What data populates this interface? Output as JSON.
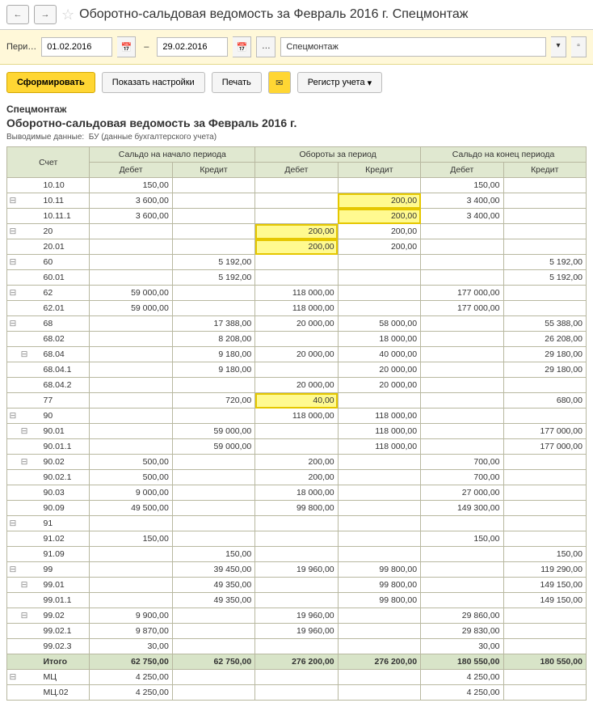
{
  "header": {
    "title": "Оборотно-сальдовая ведомость за Февраль 2016 г. Спецмонтаж"
  },
  "period": {
    "label": "Пери…",
    "from": "01.02.2016",
    "to": "29.02.2016",
    "org": "Спецмонтаж"
  },
  "toolbar": {
    "form": "Сформировать",
    "settings": "Показать настройки",
    "print": "Печать",
    "registry": "Регистр учета"
  },
  "report": {
    "org": "Спецмонтаж",
    "title": "Оборотно-сальдовая ведомость за Февраль 2016 г.",
    "meta_label": "Выводимые данные:",
    "meta_value": "БУ (данные бухгалтерского учета)",
    "cols": {
      "acct": "Счет",
      "open": "Сальдо на начало периода",
      "turn": "Обороты за период",
      "close": "Сальдо на конец периода",
      "debit": "Дебет",
      "credit": "Кредит"
    },
    "total_label": "Итого",
    "rows": [
      {
        "tree": [
          "",
          "",
          ""
        ],
        "acct": "10.10",
        "od": "150,00",
        "oc": "",
        "td": "",
        "tc": "",
        "cd": "150,00",
        "cc": ""
      },
      {
        "tree": [
          "⊟",
          "",
          ""
        ],
        "acct": "10.11",
        "od": "3 600,00",
        "oc": "",
        "td": "",
        "tc": "200,00",
        "cd": "3 400,00",
        "cc": "",
        "tc_hl": true
      },
      {
        "tree": [
          "",
          "",
          ""
        ],
        "acct": "10.11.1",
        "od": "3 600,00",
        "oc": "",
        "td": "",
        "tc": "200,00",
        "cd": "3 400,00",
        "cc": "",
        "tc_hl": true
      },
      {
        "tree": [
          "⊟",
          "",
          ""
        ],
        "acct": "20",
        "od": "",
        "oc": "",
        "td": "200,00",
        "tc": "200,00",
        "cd": "",
        "cc": "",
        "td_hl": true
      },
      {
        "tree": [
          "",
          "",
          ""
        ],
        "acct": "20.01",
        "od": "",
        "oc": "",
        "td": "200,00",
        "tc": "200,00",
        "cd": "",
        "cc": "",
        "td_hl": true
      },
      {
        "tree": [
          "⊟",
          "",
          ""
        ],
        "acct": "60",
        "od": "",
        "oc": "5 192,00",
        "td": "",
        "tc": "",
        "cd": "",
        "cc": "5 192,00"
      },
      {
        "tree": [
          "",
          "",
          ""
        ],
        "acct": "60.01",
        "od": "",
        "oc": "5 192,00",
        "td": "",
        "tc": "",
        "cd": "",
        "cc": "5 192,00"
      },
      {
        "tree": [
          "⊟",
          "",
          ""
        ],
        "acct": "62",
        "od": "59 000,00",
        "oc": "",
        "td": "118 000,00",
        "tc": "",
        "cd": "177 000,00",
        "cc": ""
      },
      {
        "tree": [
          "",
          "",
          ""
        ],
        "acct": "62.01",
        "od": "59 000,00",
        "oc": "",
        "td": "118 000,00",
        "tc": "",
        "cd": "177 000,00",
        "cc": ""
      },
      {
        "tree": [
          "⊟",
          "",
          ""
        ],
        "acct": "68",
        "od": "",
        "oc": "17 388,00",
        "td": "20 000,00",
        "tc": "58 000,00",
        "cd": "",
        "cc": "55 388,00"
      },
      {
        "tree": [
          "",
          "",
          ""
        ],
        "acct": "68.02",
        "od": "",
        "oc": "8 208,00",
        "td": "",
        "tc": "18 000,00",
        "cd": "",
        "cc": "26 208,00"
      },
      {
        "tree": [
          "",
          "⊟",
          ""
        ],
        "acct": "68.04",
        "od": "",
        "oc": "9 180,00",
        "td": "20 000,00",
        "tc": "40 000,00",
        "cd": "",
        "cc": "29 180,00"
      },
      {
        "tree": [
          "",
          "",
          ""
        ],
        "acct": "68.04.1",
        "od": "",
        "oc": "9 180,00",
        "td": "",
        "tc": "20 000,00",
        "cd": "",
        "cc": "29 180,00"
      },
      {
        "tree": [
          "",
          "",
          ""
        ],
        "acct": "68.04.2",
        "od": "",
        "oc": "",
        "td": "20 000,00",
        "tc": "20 000,00",
        "cd": "",
        "cc": ""
      },
      {
        "tree": [
          "",
          "",
          ""
        ],
        "acct": "77",
        "od": "",
        "oc": "720,00",
        "td": "40,00",
        "tc": "",
        "cd": "",
        "cc": "680,00",
        "td_hl": true
      },
      {
        "tree": [
          "⊟",
          "",
          ""
        ],
        "acct": "90",
        "od": "",
        "oc": "",
        "td": "118 000,00",
        "tc": "118 000,00",
        "cd": "",
        "cc": ""
      },
      {
        "tree": [
          "",
          "⊟",
          ""
        ],
        "acct": "90.01",
        "od": "",
        "oc": "59 000,00",
        "td": "",
        "tc": "118 000,00",
        "cd": "",
        "cc": "177 000,00"
      },
      {
        "tree": [
          "",
          "",
          ""
        ],
        "acct": "90.01.1",
        "od": "",
        "oc": "59 000,00",
        "td": "",
        "tc": "118 000,00",
        "cd": "",
        "cc": "177 000,00"
      },
      {
        "tree": [
          "",
          "⊟",
          ""
        ],
        "acct": "90.02",
        "od": "500,00",
        "oc": "",
        "td": "200,00",
        "tc": "",
        "cd": "700,00",
        "cc": ""
      },
      {
        "tree": [
          "",
          "",
          ""
        ],
        "acct": "90.02.1",
        "od": "500,00",
        "oc": "",
        "td": "200,00",
        "tc": "",
        "cd": "700,00",
        "cc": ""
      },
      {
        "tree": [
          "",
          "",
          ""
        ],
        "acct": "90.03",
        "od": "9 000,00",
        "oc": "",
        "td": "18 000,00",
        "tc": "",
        "cd": "27 000,00",
        "cc": ""
      },
      {
        "tree": [
          "",
          "",
          ""
        ],
        "acct": "90.09",
        "od": "49 500,00",
        "oc": "",
        "td": "99 800,00",
        "tc": "",
        "cd": "149 300,00",
        "cc": ""
      },
      {
        "tree": [
          "⊟",
          "",
          ""
        ],
        "acct": "91",
        "od": "",
        "oc": "",
        "td": "",
        "tc": "",
        "cd": "",
        "cc": ""
      },
      {
        "tree": [
          "",
          "",
          ""
        ],
        "acct": "91.02",
        "od": "150,00",
        "oc": "",
        "td": "",
        "tc": "",
        "cd": "150,00",
        "cc": ""
      },
      {
        "tree": [
          "",
          "",
          ""
        ],
        "acct": "91.09",
        "od": "",
        "oc": "150,00",
        "td": "",
        "tc": "",
        "cd": "",
        "cc": "150,00"
      },
      {
        "tree": [
          "⊟",
          "",
          ""
        ],
        "acct": "99",
        "od": "",
        "oc": "39 450,00",
        "td": "19 960,00",
        "tc": "99 800,00",
        "cd": "",
        "cc": "119 290,00"
      },
      {
        "tree": [
          "",
          "⊟",
          ""
        ],
        "acct": "99.01",
        "od": "",
        "oc": "49 350,00",
        "td": "",
        "tc": "99 800,00",
        "cd": "",
        "cc": "149 150,00"
      },
      {
        "tree": [
          "",
          "",
          ""
        ],
        "acct": "99.01.1",
        "od": "",
        "oc": "49 350,00",
        "td": "",
        "tc": "99 800,00",
        "cd": "",
        "cc": "149 150,00"
      },
      {
        "tree": [
          "",
          "⊟",
          ""
        ],
        "acct": "99.02",
        "od": "9 900,00",
        "oc": "",
        "td": "19 960,00",
        "tc": "",
        "cd": "29 860,00",
        "cc": ""
      },
      {
        "tree": [
          "",
          "",
          ""
        ],
        "acct": "99.02.1",
        "od": "9 870,00",
        "oc": "",
        "td": "19 960,00",
        "tc": "",
        "cd": "29 830,00",
        "cc": ""
      },
      {
        "tree": [
          "",
          "",
          ""
        ],
        "acct": "99.02.3",
        "od": "30,00",
        "oc": "",
        "td": "",
        "tc": "",
        "cd": "30,00",
        "cc": ""
      }
    ],
    "totals": {
      "od": "62 750,00",
      "oc": "62 750,00",
      "td": "276 200,00",
      "tc": "276 200,00",
      "cd": "180 550,00",
      "cc": "180 550,00"
    },
    "after": [
      {
        "tree": [
          "⊟",
          "",
          ""
        ],
        "acct": "МЦ",
        "od": "4 250,00",
        "oc": "",
        "td": "",
        "tc": "",
        "cd": "4 250,00",
        "cc": ""
      },
      {
        "tree": [
          "",
          "",
          ""
        ],
        "acct": "МЦ.02",
        "od": "4 250,00",
        "oc": "",
        "td": "",
        "tc": "",
        "cd": "4 250,00",
        "cc": ""
      }
    ]
  }
}
